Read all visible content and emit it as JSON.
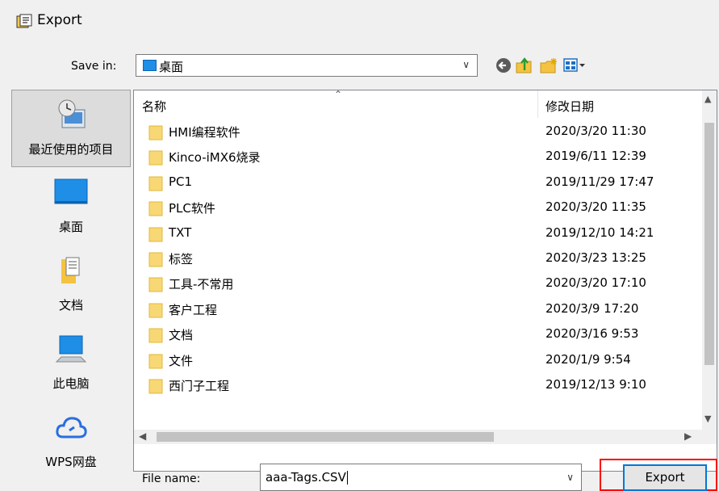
{
  "window": {
    "title": "Export"
  },
  "toolbar": {
    "save_in_label": "Save in:",
    "save_in_value": "桌面",
    "icons": [
      "back-icon",
      "up-folder-icon",
      "new-folder-icon",
      "view-menu-icon"
    ]
  },
  "places": [
    {
      "label": "最近使用的项目",
      "icon": "recent-items-icon",
      "selected": true
    },
    {
      "label": "桌面",
      "icon": "desktop-icon",
      "selected": false
    },
    {
      "label": "文档",
      "icon": "documents-icon",
      "selected": false
    },
    {
      "label": "此电脑",
      "icon": "this-pc-icon",
      "selected": false
    },
    {
      "label": "WPS网盘",
      "icon": "wps-cloud-icon",
      "selected": false
    }
  ],
  "file_list": {
    "columns": {
      "name": "名称",
      "date": "修改日期"
    },
    "rows": [
      {
        "name": "HMI编程软件",
        "date": "2020/3/20 11:30"
      },
      {
        "name": "Kinco-iMX6烧录",
        "date": "2019/6/11 12:39"
      },
      {
        "name": "PC1",
        "date": "2019/11/29 17:47"
      },
      {
        "name": "PLC软件",
        "date": "2020/3/20 11:35"
      },
      {
        "name": "TXT",
        "date": "2019/12/10 14:21"
      },
      {
        "name": "标签",
        "date": "2020/3/23 13:25"
      },
      {
        "name": "工具-不常用",
        "date": "2020/3/20 17:10"
      },
      {
        "name": "客户工程",
        "date": "2020/3/9 17:20"
      },
      {
        "name": "文档",
        "date": "2020/3/16 9:53"
      },
      {
        "name": "文件",
        "date": "2020/1/9 9:54"
      },
      {
        "name": "西门子工程",
        "date": "2019/12/13 9:10"
      }
    ]
  },
  "footer": {
    "file_name_label": "File name:",
    "file_name_value": "aaa-Tags.CSV",
    "export_label": "Export"
  },
  "colors": {
    "accent": "#0078d7",
    "highlight_outline": "#ff0000",
    "folder": "#f8d775"
  }
}
